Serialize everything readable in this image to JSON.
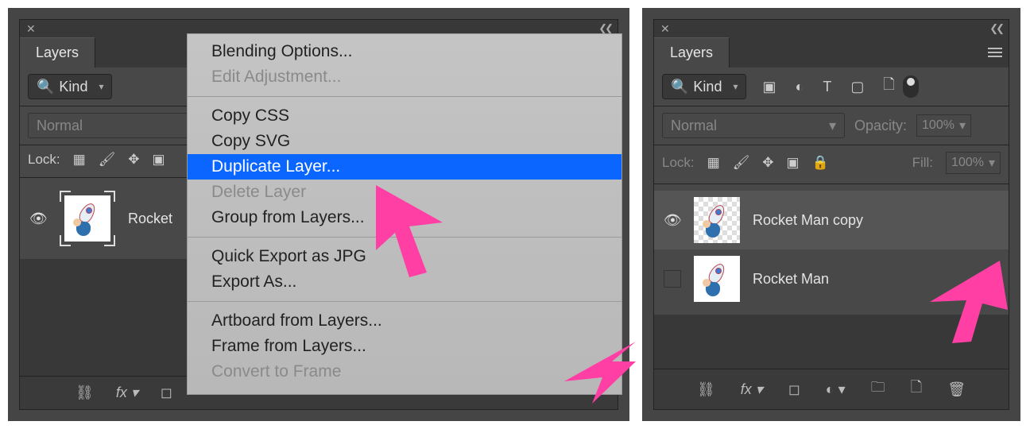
{
  "left": {
    "panel_title": "Layers",
    "filter": {
      "label": "Kind"
    },
    "blend_mode": "Normal",
    "lock_label": "Lock:",
    "layer_name_truncated": "Rocket",
    "context_menu": {
      "items": [
        {
          "label": "Blending Options...",
          "enabled": true
        },
        {
          "label": "Edit Adjustment...",
          "enabled": false
        },
        {
          "sep": true
        },
        {
          "label": "Copy CSS",
          "enabled": true
        },
        {
          "label": "Copy SVG",
          "enabled": true
        },
        {
          "label": "Duplicate Layer...",
          "enabled": true,
          "highlighted": true
        },
        {
          "label": "Delete Layer",
          "enabled": false
        },
        {
          "label": "Group from Layers...",
          "enabled": true
        },
        {
          "sep": true
        },
        {
          "label": "Quick Export as JPG",
          "enabled": true
        },
        {
          "label": "Export As...",
          "enabled": true
        },
        {
          "sep": true
        },
        {
          "label": "Artboard from Layers...",
          "enabled": true
        },
        {
          "label": "Frame from Layers...",
          "enabled": true
        },
        {
          "label": "Convert to Frame",
          "enabled": false
        }
      ]
    }
  },
  "right": {
    "panel_title": "Layers",
    "filter": {
      "label": "Kind"
    },
    "blend_mode": "Normal",
    "opacity_label": "Opacity:",
    "opacity_value": "100%",
    "lock_label": "Lock:",
    "fill_label": "Fill:",
    "fill_value": "100%",
    "layers": [
      {
        "name": "Rocket Man copy",
        "visible": true,
        "selected": true,
        "transparent_bg": true
      },
      {
        "name": "Rocket Man",
        "visible": false,
        "selected": false,
        "transparent_bg": false
      }
    ]
  }
}
